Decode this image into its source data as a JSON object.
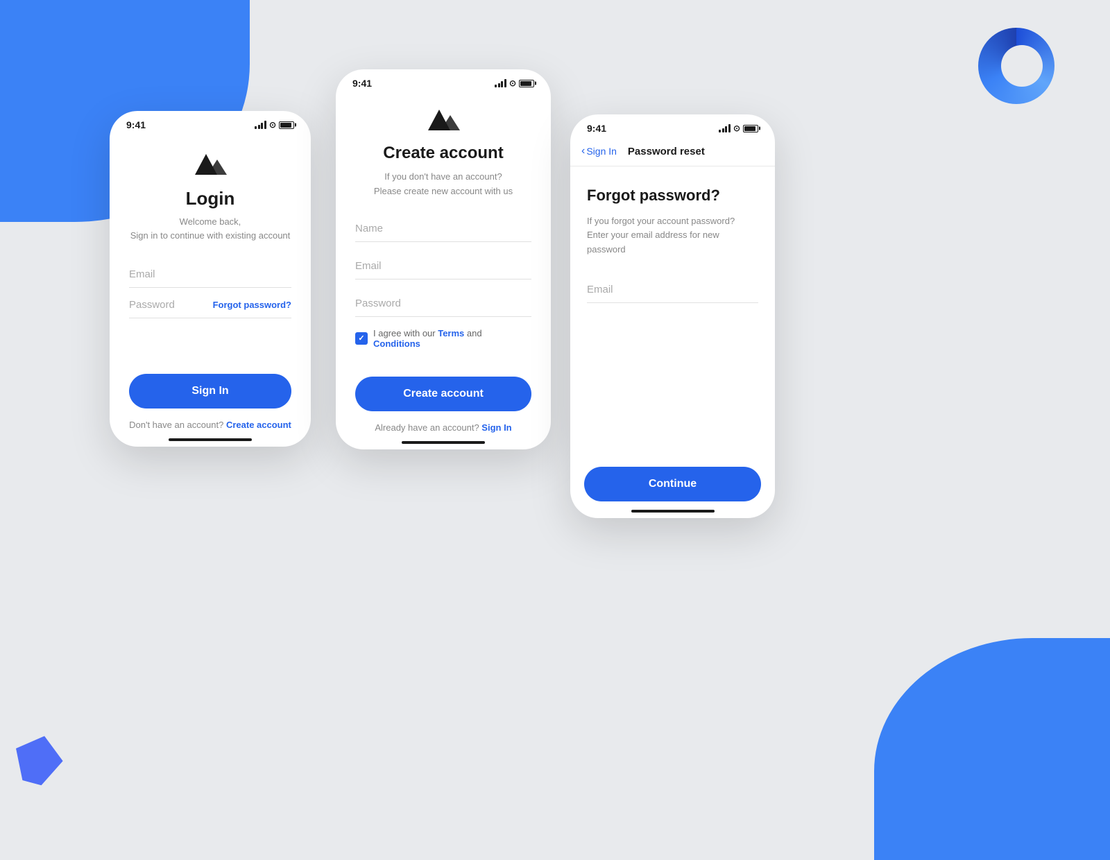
{
  "background": {
    "color": "#e8eaed"
  },
  "decorations": {
    "diamond_color": "#4f6ef7",
    "ring_color": "#3b82f6"
  },
  "phone_login": {
    "status_time": "9:41",
    "title": "Login",
    "subtitle_line1": "Welcome back,",
    "subtitle_line2": "Sign in to continue with existing account",
    "email_placeholder": "Email",
    "password_placeholder": "Password",
    "forgot_link": "Forgot password?",
    "sign_in_button": "Sign In",
    "footer_text": "Don't have an account?",
    "create_link": "Create account"
  },
  "phone_create": {
    "status_time": "9:41",
    "title": "Create account",
    "subtitle_line1": "If you don't have an account?",
    "subtitle_line2": "Please create new account with us",
    "name_placeholder": "Name",
    "email_placeholder": "Email",
    "password_placeholder": "Password",
    "terms_prefix": "I agree with our ",
    "terms_link": "Terms",
    "terms_middle": " and ",
    "conditions_link": "Conditions",
    "create_button": "Create account",
    "already_text": "Already have an account?",
    "sign_in_link": "Sign In"
  },
  "phone_reset": {
    "status_time": "9:41",
    "back_label": "Sign In",
    "nav_title": "Password reset",
    "title": "Forgot password?",
    "subtitle_line1": "If you forgot your account password?",
    "subtitle_line2": "Enter your email address for new password",
    "email_placeholder": "Email",
    "continue_button": "Continue"
  }
}
